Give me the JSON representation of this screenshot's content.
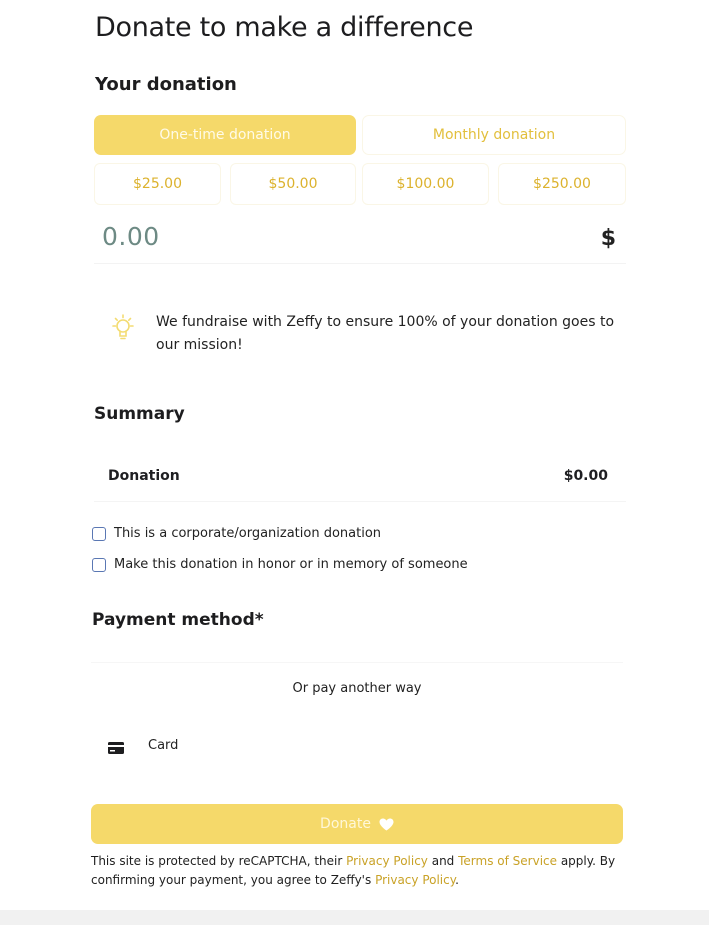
{
  "page": {
    "title": "Donate to make a difference"
  },
  "donation": {
    "heading": "Your donation",
    "tabs": [
      {
        "label": "One-time donation",
        "active": true
      },
      {
        "label": "Monthly donation",
        "active": false
      }
    ],
    "preset_amounts": [
      "$25.00",
      "$50.00",
      "$100.00",
      "$250.00"
    ],
    "amount_value": "0.00",
    "currency_symbol": "$",
    "info_text": "We fundraise with Zeffy to ensure 100% of your donation goes to our mission!",
    "info_icon": "lightbulb-icon"
  },
  "summary": {
    "heading": "Summary",
    "row_label": "Donation",
    "row_value": "$0.00",
    "checkboxes": [
      {
        "label": "This is a corporate/organization donation",
        "checked": false
      },
      {
        "label": "Make this donation in honor or in memory of someone",
        "checked": false
      }
    ]
  },
  "payment": {
    "heading": "Payment method*",
    "alt_label": "Or pay another way",
    "card_label": "Card",
    "card_icon": "credit-card-icon"
  },
  "donate_button": {
    "label": "Donate",
    "icon": "heart-icon"
  },
  "legal": {
    "part1": "This site is protected by reCAPTCHA, their ",
    "link1": "Privacy Policy",
    "part2": " and ",
    "link2": "Terms of Service",
    "part3": " apply. By confirming your payment, you agree to Zeffy's ",
    "link3": "Privacy Policy",
    "part4": "."
  },
  "colors": {
    "accent": "#f5d96a",
    "accent_text": "#dcb22d",
    "amount_text": "#6d8a84",
    "checkbox_border": "#5a77b3"
  }
}
